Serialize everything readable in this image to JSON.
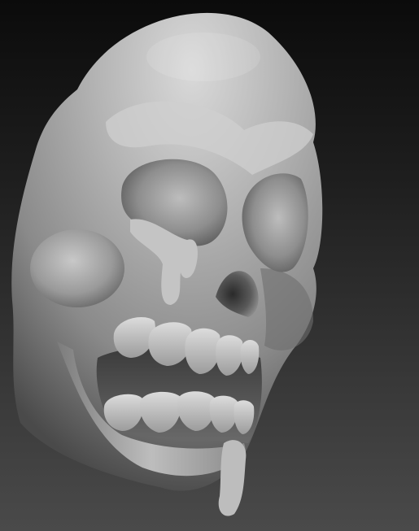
{
  "scene": {
    "subject": "skull-sculpt",
    "background_top_color": "#0b0b0b",
    "background_bottom_color": "#4a4a4a",
    "material_color": "#a9a9a9"
  }
}
